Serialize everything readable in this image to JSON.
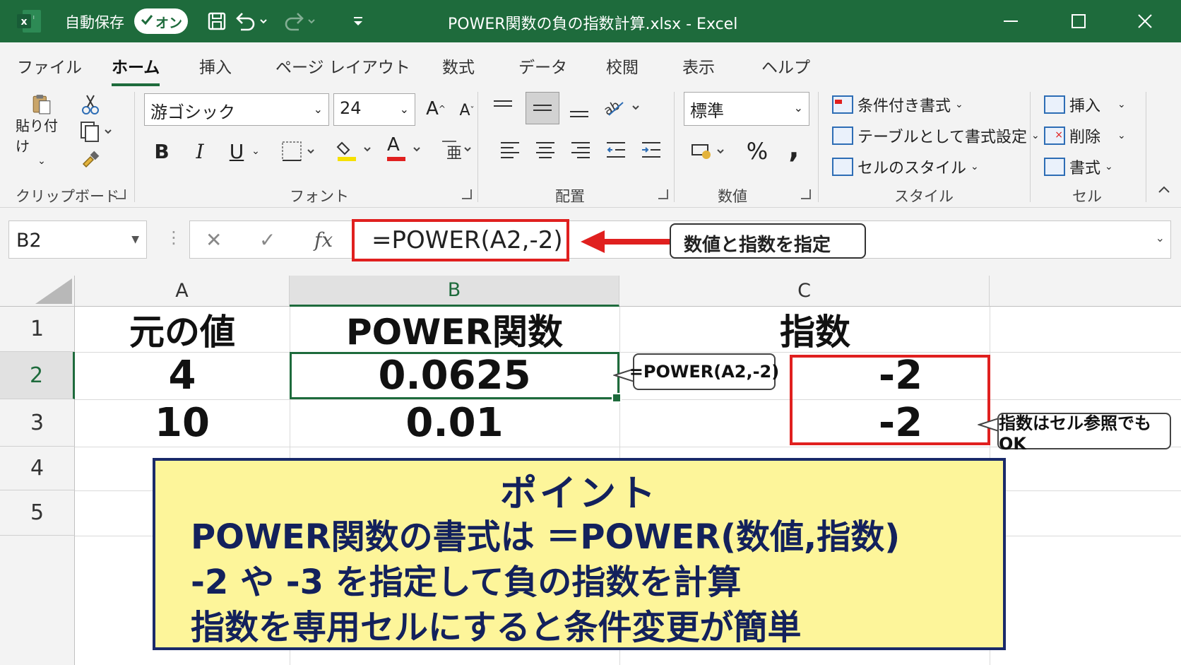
{
  "titlebar": {
    "autosave_label": "自動保存",
    "autosave_state": "オン",
    "file_title": "POWER関数の負の指数計算.xlsx  -  Excel"
  },
  "tabs": [
    "ファイル",
    "ホーム",
    "挿入",
    "ページ レイアウト",
    "数式",
    "データ",
    "校閲",
    "表示",
    "ヘルプ"
  ],
  "active_tab": "ホーム",
  "ribbon": {
    "clipboard": {
      "paste_label": "貼り付け",
      "group_label": "クリップボード"
    },
    "font": {
      "font_name": "游ゴシック",
      "font_size": "24",
      "bold": "B",
      "italic": "I",
      "underline": "U",
      "group_label": "フォント",
      "grow": "A",
      "shrink": "A",
      "font_color_letter": "A"
    },
    "alignment": {
      "group_label": "配置"
    },
    "number": {
      "format": "標準",
      "percent": "%",
      "comma": ",",
      "group_label": "数値"
    },
    "styles": {
      "conditional": "条件付き書式",
      "table": "テーブルとして書式設定",
      "cell_styles": "セルのスタイル",
      "group_label": "スタイル"
    },
    "cells": {
      "insert": "挿入",
      "delete": "削除",
      "format": "書式",
      "group_label": "セル"
    }
  },
  "formula_bar": {
    "name_box": "B2",
    "fx": "fx",
    "formula": "=POWER(A2,-2)",
    "callout": "数値と指数を指定"
  },
  "sheet": {
    "columns": [
      "A",
      "B",
      "C"
    ],
    "rows": [
      "1",
      "2",
      "3",
      "4",
      "5"
    ],
    "selected_cell": "B2",
    "cells": {
      "A1": "元の値",
      "B1": "POWER関数",
      "C1": "指数",
      "A2": "4",
      "B2": "0.0625",
      "C2": "-2",
      "A3": "10",
      "B3": "0.01",
      "C3": "-2"
    },
    "bubble_formula": "=POWER(A2,-2)",
    "bubble_ref": "指数はセル参照でもOK"
  },
  "point_box": {
    "title": "ポイント",
    "lines": [
      "POWER関数の書式は ＝POWER(数値,指数)",
      "-2 や -3 を指定して負の指数を計算",
      "指数を専用セルにすると条件変更が簡単"
    ]
  },
  "colors": {
    "excel_green": "#1e6b3c",
    "highlight_red": "#e0201f",
    "note_yellow": "#fdf59a",
    "note_navy": "#13215c"
  }
}
